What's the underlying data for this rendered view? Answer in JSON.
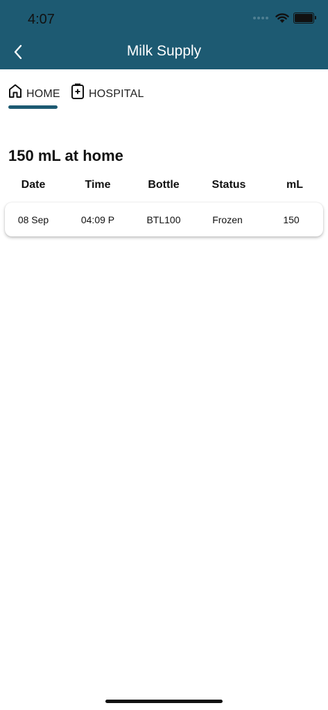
{
  "status_bar": {
    "time": "4:07",
    "icons": [
      "signal-dots-icon",
      "wifi-icon",
      "battery-icon"
    ]
  },
  "header": {
    "title": "Milk Supply",
    "back_icon": "chevron-left-icon",
    "background_color": "#1d5a72"
  },
  "tabs": [
    {
      "label": "HOME",
      "icon": "home-icon",
      "selected": true
    },
    {
      "label": "HOSPITAL",
      "icon": "hospital-icon",
      "selected": false
    }
  ],
  "accent_color": "#1d5a72",
  "summary": "150 mL at home",
  "table": {
    "columns": [
      "Date",
      "Time",
      "Bottle",
      "Status",
      "mL"
    ],
    "rows": [
      [
        "08 Sep",
        "04:09 P",
        "BTL100",
        "Frozen",
        "150"
      ]
    ]
  }
}
